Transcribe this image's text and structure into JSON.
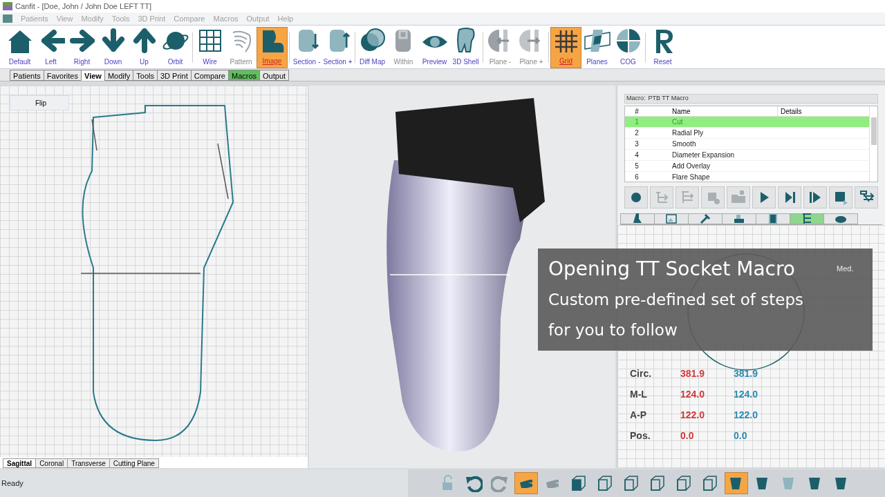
{
  "window": {
    "title": "Canfit - [Doe, John / John Doe LEFT TT]"
  },
  "menu": [
    {
      "label": "Patients"
    },
    {
      "label": "View"
    },
    {
      "label": "Modify"
    },
    {
      "label": "Tools"
    },
    {
      "label": "3D Print"
    },
    {
      "label": "Compare"
    },
    {
      "label": "Macros"
    },
    {
      "label": "Output"
    },
    {
      "label": "Help"
    }
  ],
  "ribbon": [
    {
      "label": "Default",
      "selected": false,
      "disabled": false
    },
    {
      "label": "Left",
      "selected": false,
      "disabled": false
    },
    {
      "label": "Right",
      "selected": false,
      "disabled": false
    },
    {
      "label": "Down",
      "selected": false,
      "disabled": false
    },
    {
      "label": "Up",
      "selected": false,
      "disabled": false
    },
    {
      "label": "Orbit",
      "selected": false,
      "disabled": false
    },
    {
      "label": "Wire",
      "selected": false,
      "disabled": false
    },
    {
      "label": "Pattern",
      "selected": false,
      "disabled": true
    },
    {
      "label": "Image",
      "selected": true,
      "disabled": false
    },
    {
      "label": "Section -",
      "selected": false,
      "disabled": false
    },
    {
      "label": "Section +",
      "selected": false,
      "disabled": false
    },
    {
      "label": "Diff Map",
      "selected": false,
      "disabled": false
    },
    {
      "label": "Within",
      "selected": false,
      "disabled": true
    },
    {
      "label": "Preview",
      "selected": false,
      "disabled": false
    },
    {
      "label": "3D Shell",
      "selected": false,
      "disabled": false
    },
    {
      "label": "Plane -",
      "selected": false,
      "disabled": true
    },
    {
      "label": "Plane +",
      "selected": false,
      "disabled": true
    },
    {
      "label": "Grid",
      "selected": true,
      "disabled": false
    },
    {
      "label": "Planes",
      "selected": false,
      "disabled": false
    },
    {
      "label": "COG",
      "selected": false,
      "disabled": false
    },
    {
      "label": "Reset",
      "selected": false,
      "disabled": false
    }
  ],
  "ribbon_tabs": [
    {
      "label": "Patients",
      "selected": false,
      "highlighted": false
    },
    {
      "label": "Favorites",
      "selected": false,
      "highlighted": false
    },
    {
      "label": "View",
      "selected": true,
      "highlighted": false
    },
    {
      "label": "Modify",
      "selected": false,
      "highlighted": false
    },
    {
      "label": "Tools",
      "selected": false,
      "highlighted": false
    },
    {
      "label": "3D Print",
      "selected": false,
      "highlighted": false
    },
    {
      "label": "Compare",
      "selected": false,
      "highlighted": false
    },
    {
      "label": "Macros",
      "selected": false,
      "highlighted": true
    },
    {
      "label": "Output",
      "selected": false,
      "highlighted": false
    }
  ],
  "left_view": {
    "button": "Flip",
    "tabs": [
      {
        "label": "Sagittal",
        "selected": true
      },
      {
        "label": "Coronal",
        "selected": false
      },
      {
        "label": "Transverse",
        "selected": false
      },
      {
        "label": "Cutting Plane",
        "selected": false
      }
    ]
  },
  "macro": {
    "label": "Macro:",
    "name": "PTB TT Macro",
    "columns": [
      "#",
      "Name",
      "Details"
    ],
    "rows": [
      {
        "num": "1",
        "name": "Cut",
        "selected": true
      },
      {
        "num": "2",
        "name": "Radial Ply",
        "selected": false
      },
      {
        "num": "3",
        "name": "Smooth",
        "selected": false
      },
      {
        "num": "4",
        "name": "Diameter Expansion",
        "selected": false
      },
      {
        "num": "5",
        "name": "Add Overlay",
        "selected": false
      },
      {
        "num": "6",
        "name": "Flare Shape",
        "selected": false
      }
    ],
    "controls": [
      {
        "disabled": false
      },
      {
        "disabled": true
      },
      {
        "disabled": true
      },
      {
        "disabled": true
      },
      {
        "disabled": true
      },
      {
        "disabled": false
      },
      {
        "disabled": false
      },
      {
        "disabled": false
      },
      {
        "disabled": false
      },
      {
        "disabled": false
      }
    ]
  },
  "panel_tabs": [
    {
      "selected": false
    },
    {
      "selected": false
    },
    {
      "selected": false
    },
    {
      "selected": false
    },
    {
      "selected": false
    },
    {
      "selected": true
    },
    {
      "selected": false
    }
  ],
  "section_view": {
    "side_label": "Med.",
    "measurements": [
      {
        "label": "Circ.",
        "value_1": "381.9",
        "value_2": "381.9"
      },
      {
        "label": "M-L",
        "value_1": "124.0",
        "value_2": "124.0"
      },
      {
        "label": "A-P",
        "value_1": "122.0",
        "value_2": "122.0"
      },
      {
        "label": "Pos.",
        "value_1": "0.0",
        "value_2": "0.0"
      }
    ]
  },
  "caption": {
    "title": "Opening TT Socket Macro",
    "lines": [
      "Custom pre-defined set of steps",
      "for you to follow"
    ]
  },
  "status_bar": {
    "text": "Ready",
    "tools": [
      {
        "selected": false
      },
      {
        "selected": false
      },
      {
        "selected": false
      },
      {
        "selected": true
      },
      {
        "selected": false
      },
      {
        "selected": false
      },
      {
        "selected": false
      },
      {
        "selected": false
      },
      {
        "selected": false
      },
      {
        "selected": false
      },
      {
        "selected": false
      },
      {
        "selected": true
      },
      {
        "selected": false
      },
      {
        "selected": false
      },
      {
        "selected": false
      },
      {
        "selected": false
      }
    ]
  }
}
